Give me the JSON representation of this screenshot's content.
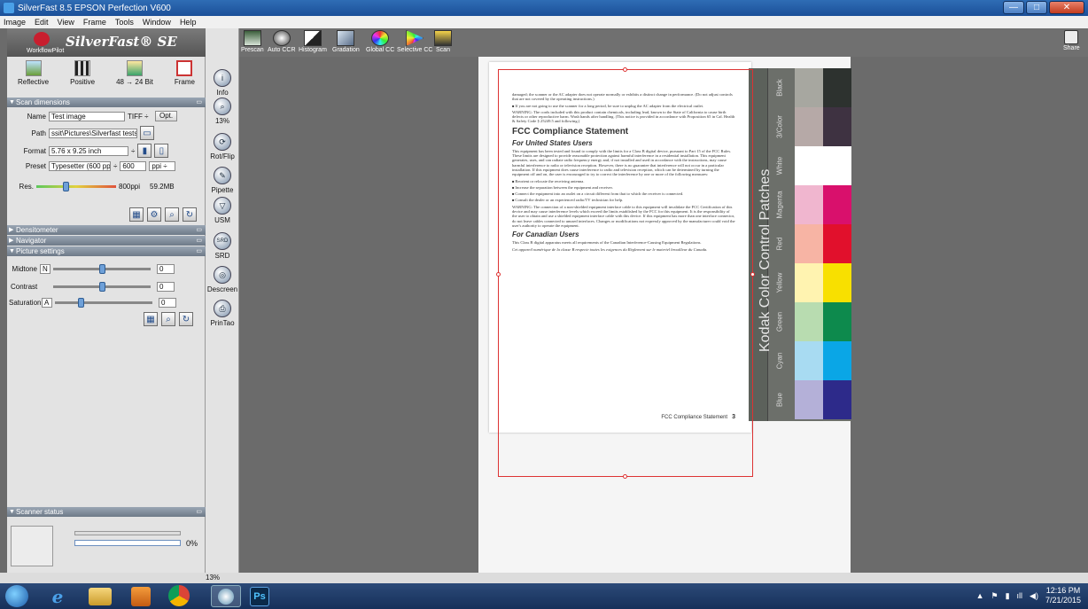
{
  "window": {
    "title": "SilverFast 8.5 EPSON Perfection V600",
    "minimize": "—",
    "maximize": "□",
    "close": "✕"
  },
  "menu": [
    "Image",
    "Edit",
    "View",
    "Frame",
    "Tools",
    "Window",
    "Help"
  ],
  "logo": {
    "brand": "SilverFast® SE",
    "workflow": "WorkflowPilot"
  },
  "modes": [
    {
      "label": "Reflective",
      "icon": "reflective-icon"
    },
    {
      "label": "Positive",
      "icon": "film-strip-icon"
    },
    {
      "label": "48 → 24 Bit",
      "icon": "bit-depth-icon"
    },
    {
      "label": "Frame",
      "icon": "frame-icon"
    }
  ],
  "scan_dimensions": {
    "header": "Scan dimensions",
    "name_label": "Name",
    "name_value": "Test image",
    "format_type": "TIFF ÷",
    "opt_button": "Opt.",
    "path_label": "Path",
    "path_value": "ssit\\Pictures\\Silverfast tests",
    "format_label": "Format",
    "format_value": "5.76 x 9.25 inch",
    "format_arrow": "÷",
    "preset_label": "Preset",
    "preset_value": "Typesetter (600 ppi)",
    "preset_arrow": "÷",
    "ppi_value": "600",
    "ppi_unit": "ppi ÷",
    "res_label": "Res.",
    "res_value": "800ppi",
    "file_size": "59.2MB"
  },
  "sections": {
    "densitometer": "Densitometer",
    "navigator": "Navigator",
    "picture_settings": "Picture settings",
    "scanner_status": "Scanner status"
  },
  "picture_settings": {
    "midtone_label": "Midtone",
    "midtone_mode": "N",
    "midtone_value": "0",
    "contrast_label": "Contrast",
    "contrast_value": "0",
    "saturation_label": "Saturation",
    "saturation_mode": "A",
    "saturation_value": "0"
  },
  "scanner_status": {
    "progress_percent": "0%",
    "progress": 0
  },
  "tools": [
    {
      "label": "Info",
      "glyph": "i",
      "icon": "info-icon"
    },
    {
      "label": "13%",
      "glyph": "⌕",
      "icon": "zoom-icon"
    },
    {
      "label": "Rot/Flip",
      "glyph": "⟳",
      "icon": "rotate-flip-icon"
    },
    {
      "label": "Pipette",
      "glyph": "✎",
      "icon": "pipette-icon"
    },
    {
      "label": "USM",
      "glyph": "▽",
      "icon": "usm-icon"
    },
    {
      "label": "SRD",
      "glyph": "SRD",
      "icon": "srd-icon"
    },
    {
      "label": "Descreen",
      "glyph": "◎",
      "icon": "descreen-icon"
    },
    {
      "label": "PrinTao",
      "glyph": "⎙",
      "icon": "printao-icon"
    }
  ],
  "toolbar": [
    {
      "label": "Prescan",
      "icon": "prescan-icon"
    },
    {
      "label": "Auto CCR",
      "icon": "auto-ccr-icon"
    },
    {
      "label": "Histogram",
      "icon": "histogram-icon"
    },
    {
      "label": "Gradation",
      "icon": "gradation-icon"
    },
    {
      "label": "Global CC",
      "icon": "global-cc-icon"
    },
    {
      "label": "Selective CC",
      "icon": "selective-cc-icon"
    },
    {
      "label": "Scan",
      "icon": "scan-icon"
    }
  ],
  "share_label": "Share",
  "status_zoom": "13%",
  "document": {
    "intro": "damaged; the scanner or the AC adapter does not operate normally or exhibits a distinct change in performance. (Do not adjust controls that are not covered by the operating instructions.)",
    "unplug": "If you are not going to use the scanner for a long period, be sure to unplug the AC adapter from the electrical outlet.",
    "warning1": "WARNING: The cords included with this product contain chemicals, including lead, known to the State of California to cause birth defects or other reproductive harm. Wash hands after handling. (This notice is provided in accordance with Proposition 65 in Cal. Health & Safety Code § 25249.5 and following.)",
    "title": "FCC Compliance Statement",
    "us_heading": "For United States Users",
    "us_body": "This equipment has been tested and found to comply with the limits for a Class B digital device, pursuant to Part 15 of the FCC Rules. These limits are designed to provide reasonable protection against harmful interference in a residential installation. This equipment generates, uses, and can radiate radio frequency energy and, if not installed and used in accordance with the instructions, may cause harmful interference to radio or television reception. However, there is no guarantee that interference will not occur in a particular installation. If this equipment does cause interference to radio and television reception, which can be determined by turning the equipment off and on, the user is encouraged to try to correct the interference by one or more of the following measures:",
    "bullets": [
      "Reorient or relocate the receiving antenna.",
      "Increase the separation between the equipment and receiver.",
      "Connect the equipment into an outlet on a circuit different from that to which the receiver is connected.",
      "Consult the dealer or an experienced radio/TV technician for help."
    ],
    "warning2": "WARNING: The connection of a non-shielded equipment interface cable to this equipment will invalidate the FCC Certification of this device and may cause interference levels which exceed the limits established by the FCC for this equipment. It is the responsibility of the user to obtain and use a shielded equipment interface cable with this device. If this equipment has more than one interface connector, do not leave cables connected to unused interfaces. Changes or modifications not expressly approved by the manufacturer could void the user's authority to operate the equipment.",
    "ca_heading": "For Canadian Users",
    "ca_body": "This Class B digital apparatus meets all requirements of the Canadian Interference-Causing Equipment Regulations.",
    "ca_french": "Cet appareil numérique de la classe B respecte toutes les exigences du Règlement sur le materiel brouilleur du Canada.",
    "footer": "FCC Compliance Statement",
    "page": "3"
  },
  "kodak": {
    "title": "Kodak Color Control Patches",
    "labels": [
      "Black",
      "3/Color",
      "White",
      "Magenta",
      "Red",
      "Yellow",
      "Green",
      "Cyan",
      "Blue"
    ],
    "colors": {
      "black": [
        "#a7a7a0",
        "#2d322f"
      ],
      "threecolor": [
        "#b6a9a7",
        "#3e3241"
      ],
      "white": [
        "#ffffff",
        "#ffffff"
      ],
      "magenta": [
        "#f0b6cf",
        "#d9106c"
      ],
      "red": [
        "#f7b4a4",
        "#e1102c"
      ],
      "yellow": [
        "#fff3b0",
        "#f8e000"
      ],
      "green": [
        "#b8dcb0",
        "#0d8a4d"
      ],
      "cyan": [
        "#a8dbf2",
        "#0aa6e6"
      ],
      "blue": [
        "#b4b0d8",
        "#2d2a8a"
      ]
    }
  },
  "taskbar": {
    "time": "12:16 PM",
    "date": "7/21/2015",
    "apps": [
      "start-orb-icon",
      "internet-explorer-icon",
      "file-explorer-icon",
      "media-player-icon",
      "chrome-icon",
      "silverfast-icon",
      "photoshop-icon"
    ],
    "photoshop_label": "Ps"
  }
}
